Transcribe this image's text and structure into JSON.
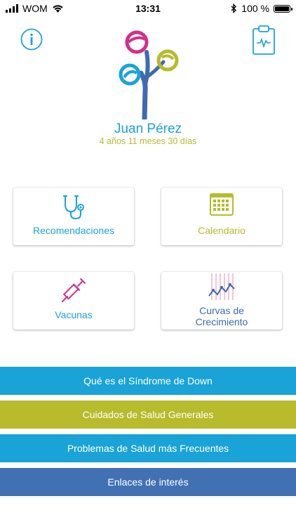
{
  "status_bar": {
    "carrier": "WOM",
    "time": "13:31",
    "battery": "100 %",
    "battery_level": 1.0
  },
  "profile": {
    "name": "Juan Pérez",
    "age": "4 años 11 meses 30 días"
  },
  "cards": [
    {
      "label": "Recomendaciones",
      "icon": "stethoscope-icon",
      "color": "#1aa3d6"
    },
    {
      "label": "Calendario",
      "icon": "calendar-icon",
      "color": "#b7bb2c"
    },
    {
      "label": "Vacunas",
      "icon": "syringe-icon",
      "color": "#d0308a"
    },
    {
      "label": "Curvas de Crecimiento",
      "icon": "growth-chart-icon",
      "color": "#3e6bb0"
    }
  ],
  "menu": [
    {
      "label": "Qué es el Síndrome de Down",
      "color": "#1aa3d6"
    },
    {
      "label": "Cuidados de Salud Generales",
      "color": "#b7bb2c"
    },
    {
      "label": "Problemas de Salud más Frecuentes",
      "color": "#1aa3d6"
    },
    {
      "label": "Enlaces de interés",
      "color": "#4271b3"
    }
  ],
  "colors": {
    "blue": "#1aa3d6",
    "olive": "#b7bb2c",
    "magenta": "#d0308a",
    "navy": "#3e6bb0"
  }
}
